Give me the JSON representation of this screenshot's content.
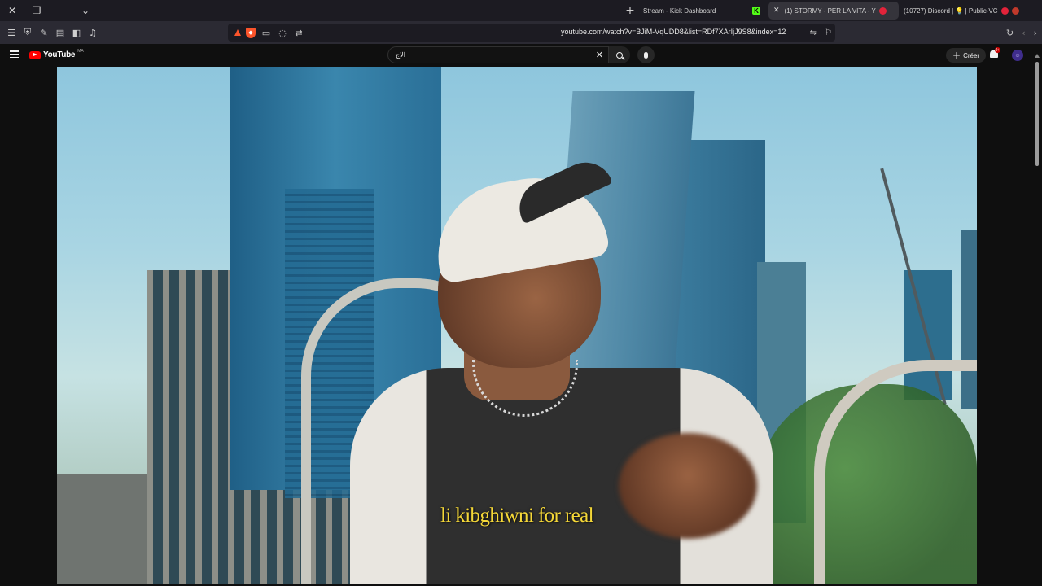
{
  "browser": {
    "tabs": [
      {
        "title": "Stream - Kick Dashboard",
        "active": false
      },
      {
        "title": "",
        "active": false
      },
      {
        "title": "(1) STORMY - PER LA VITA - Y",
        "active": true
      },
      {
        "title": "(10727) Discord | 💡 | Public-VC",
        "active": false
      }
    ],
    "url": "youtube.com/watch?v=BJiM-VqUDD8&list=RDf7XArIjJ9S8&index=12"
  },
  "youtube": {
    "logo_text": "YouTube",
    "region": "MA",
    "search_value": "الاج",
    "create_label": "Créer",
    "notifications_count": "9+"
  },
  "video": {
    "subtitle": "li kibghiwni for real"
  },
  "colors": {
    "subtitle": "#f4d738",
    "yt_red": "#ff0000",
    "kick_green": "#53fc18"
  }
}
